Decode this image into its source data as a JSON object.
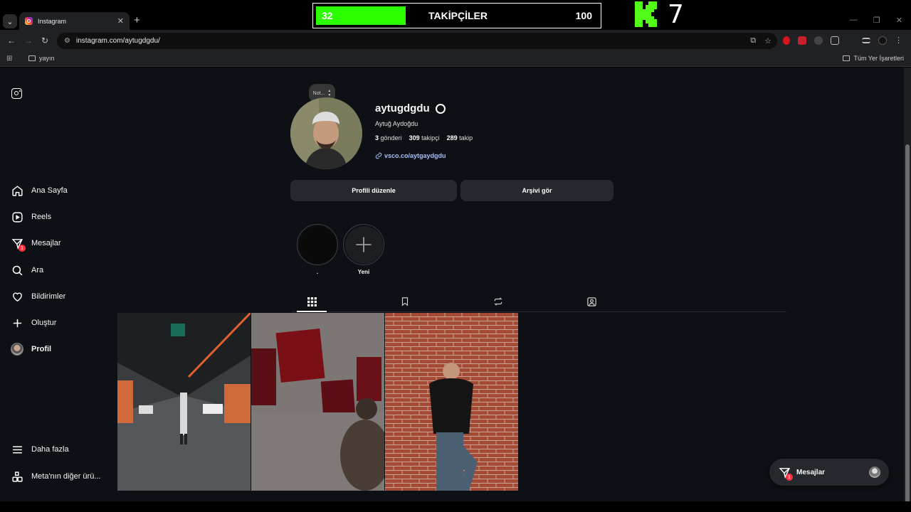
{
  "browser": {
    "tab_title": "Instagram",
    "url": "instagram.com/aytugdgdu/",
    "bookmark_folder": "yayın",
    "bookmark_all": "Tüm Yer İşaretleri"
  },
  "overlay": {
    "current": "32",
    "label": "TAKİPÇİLER",
    "goal": "100",
    "progress_fraction": 0.32,
    "k_count": "7",
    "fill_color": "#2bff00"
  },
  "sidebar": {
    "items": [
      {
        "label": "Ana Sayfa",
        "icon": "home-icon"
      },
      {
        "label": "Reels",
        "icon": "reels-icon"
      },
      {
        "label": "Mesajlar",
        "icon": "messages-icon",
        "badge": "1"
      },
      {
        "label": "Ara",
        "icon": "search-icon"
      },
      {
        "label": "Bildirimler",
        "icon": "heart-icon"
      },
      {
        "label": "Oluştur",
        "icon": "plus-icon"
      },
      {
        "label": "Profil",
        "icon": "avatar"
      }
    ],
    "more": "Daha fazla",
    "meta": "Meta'nın diğer ürü..."
  },
  "profile": {
    "note": "Not...",
    "username": "aytugdgdu",
    "full_name": "Aytuğ Aydoğdu",
    "posts_count": "3",
    "posts_label": "gönderi",
    "followers_count": "309",
    "followers_label": "takipçi",
    "following_count": "289",
    "following_label": "takip",
    "link": "vsco.co/aytgaydgdu",
    "edit_button": "Profili düzenle",
    "archive_button": "Arşivi gör"
  },
  "highlights": [
    {
      "label": "."
    },
    {
      "label": "Yeni"
    }
  ],
  "messages_pill": {
    "label": "Mesajlar",
    "badge": "1"
  },
  "accent_colors": {
    "badge": "#ff3040",
    "link": "#a9bff8",
    "button": "#25292e"
  }
}
